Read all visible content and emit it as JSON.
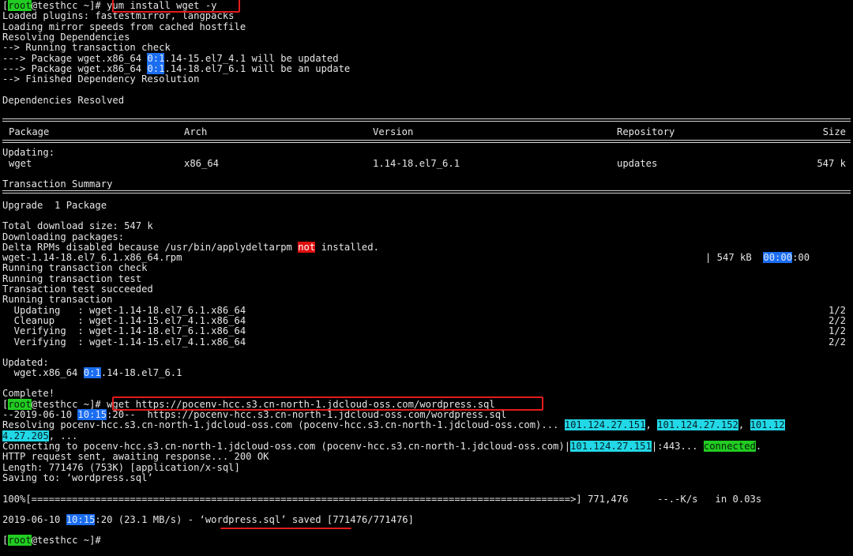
{
  "prompt": {
    "user": "root",
    "host_dir": "@testhcc ~]# "
  },
  "install_command": "yum install wget -y",
  "yum_lines": [
    "Loaded plugins: fastestmirror, langpacks",
    "Loading mirror speeds from cached hostfile",
    "Resolving Dependencies",
    "--> Running transaction check"
  ],
  "pkg_line1": {
    "prefix": "---> Package wget.x86_64 ",
    "hl": "0:1",
    "rest": ".14-15.el7_4.1 will be updated"
  },
  "pkg_line2": {
    "prefix": "---> Package wget.x86_64 ",
    "hl": "0:1",
    "rest": ".14-18.el7_6.1 will be an update"
  },
  "finished_line": "--> Finished Dependency Resolution",
  "deps_resolved": "Dependencies Resolved",
  "table": {
    "headers": {
      "package": "Package",
      "arch": "Arch",
      "version": "Version",
      "repository": "Repository",
      "size": "Size"
    },
    "updating_label": "Updating:",
    "row": {
      "package": "wget",
      "arch": "x86_64",
      "version": "1.14-18.el7_6.1",
      "repository": "updates",
      "size": "547 k"
    }
  },
  "transaction_summary": "Transaction Summary",
  "upgrade_line": "Upgrade  1 Package",
  "download_size": "Total download size: 547 k",
  "downloading": "Downloading packages:",
  "delta_line": {
    "prefix": "Delta RPMs disabled because /usr/bin/applydeltarpm ",
    "hl": "not",
    "rest": " installed."
  },
  "rpm_file": "wget-1.14-18.el7_6.1.x86_64.rpm",
  "rpm_progress": {
    "prefix": "| 547 kB  ",
    "hl": "00:00",
    "rest": ":00"
  },
  "run_lines": [
    "Running transaction check",
    "Running transaction test",
    "Transaction test succeeded",
    "Running transaction"
  ],
  "steps": [
    {
      "text": "  Updating   : wget-1.14-18.el7_6.1.x86_64",
      "count": "1/2"
    },
    {
      "text": "  Cleanup    : wget-1.14-15.el7_4.1.x86_64",
      "count": "2/2"
    },
    {
      "text": "  Verifying  : wget-1.14-18.el7_6.1.x86_64",
      "count": "1/2"
    },
    {
      "text": "  Verifying  : wget-1.14-15.el7_4.1.x86_64",
      "count": "2/2"
    }
  ],
  "updated_label": "Updated:",
  "updated_line": {
    "prefix": "  wget.x86_64 ",
    "hl": "0:1",
    "rest": ".14-18.el7_6.1"
  },
  "complete": "Complete!",
  "wget_command": "wget https://pocenv-hcc.s3.cn-north-1.jdcloud-oss.com/wordpress.sql",
  "wget_start": {
    "prefix": "--2019-06-10 ",
    "hl": "10:15",
    "rest": ":20--  https://pocenv-hcc.s3.cn-north-1.jdcloud-oss.com/wordpress.sql"
  },
  "resolving": {
    "prefix": "Resolving pocenv-hcc.s3.cn-north-1.jdcloud-oss.com (pocenv-hcc.s3.cn-north-1.jdcloud-oss.com)... ",
    "ip1": "101.124.27.151",
    "sep1": ", ",
    "ip2": "101.124.27.152",
    "sep2": ", ",
    "ip3a": "101.12"
  },
  "resolving_cont": {
    "ip3b": "4.27.205",
    "rest": ", ..."
  },
  "connecting": {
    "prefix": "Connecting to pocenv-hcc.s3.cn-north-1.jdcloud-oss.com (pocenv-hcc.s3.cn-north-1.jdcloud-oss.com)|",
    "ip": "101.124.27.151",
    "mid": "|:443... ",
    "status": "connected",
    "end": "."
  },
  "http_line": "HTTP request sent, awaiting response... 200 OK",
  "length_line": "Length: 771476 (753K) [application/x-sql]",
  "saving_line": "Saving to: ‘wordpress.sql’",
  "progress_line": "100%[=============================================================================================>] 771,476     --.-K/s   in 0.03s",
  "saved": {
    "prefix": "2019-06-10 ",
    "hl": "10:15",
    "mid": ":20 (23.1 MB/s) - ",
    "file": "‘wordpress.sql’ saved",
    "rest": " [771476/771476]"
  },
  "final_prompt_suffix": "@testhcc ~]#"
}
